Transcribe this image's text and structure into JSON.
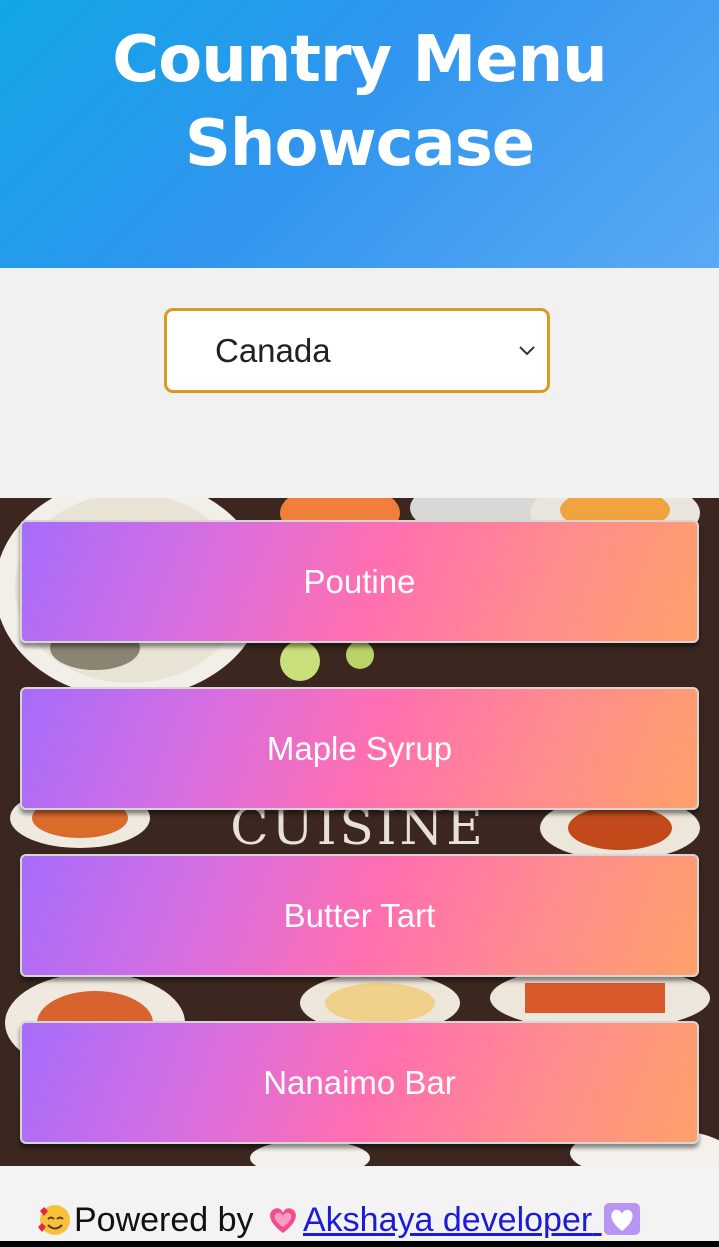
{
  "header": {
    "title_line1": "Country Menu",
    "title_line2": "Showcase"
  },
  "country_select": {
    "selected": "Canada",
    "icon": "chevron-down-icon"
  },
  "menu": {
    "background_text": "CUISINE",
    "items": [
      {
        "label": "Poutine"
      },
      {
        "label": "Maple Syrup"
      },
      {
        "label": "Butter Tart"
      },
      {
        "label": "Nanaimo Bar"
      }
    ]
  },
  "footer": {
    "prefix": "Powered by",
    "link_text": "Akshaya developer",
    "icons": [
      "smiling-face-with-hearts-icon",
      "sparkling-heart-icon",
      "white-heart-icon"
    ]
  },
  "colors": {
    "header_gradient_start": "#11a6e6",
    "header_gradient_end": "#5aa9f5",
    "select_border": "#d99a1e",
    "button_gradient_start": "#a66cfb",
    "button_gradient_mid": "#ff6fb0",
    "button_gradient_end": "#ffa06a",
    "link": "#1b1bd8"
  }
}
